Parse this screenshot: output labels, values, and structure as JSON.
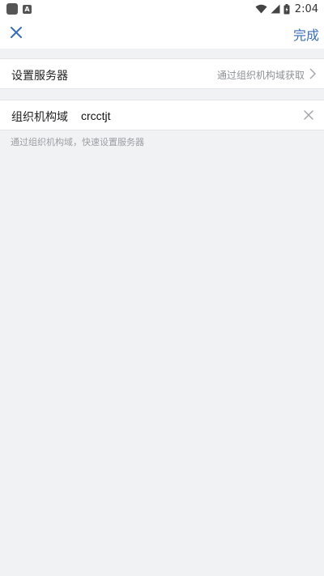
{
  "status_bar": {
    "time": "2:04",
    "icons": [
      "app-notification-icon",
      "a-notification-icon",
      "wifi-icon",
      "signal-icon",
      "battery-icon"
    ]
  },
  "nav": {
    "close_icon": "close-icon",
    "done_label": "完成"
  },
  "server_row": {
    "label": "设置服务器",
    "value": "通过组织机构域获取",
    "icon": "chevron-right-icon"
  },
  "org_row": {
    "label": "组织机构域",
    "input_value": "crcctjt",
    "clear_icon": "clear-icon"
  },
  "hint_text": "通过组织机构域，快速设置服务器",
  "colors": {
    "accent": "#3a6fb7",
    "background": "#f1f2f4",
    "card": "#ffffff",
    "muted_text": "#8e9196"
  }
}
